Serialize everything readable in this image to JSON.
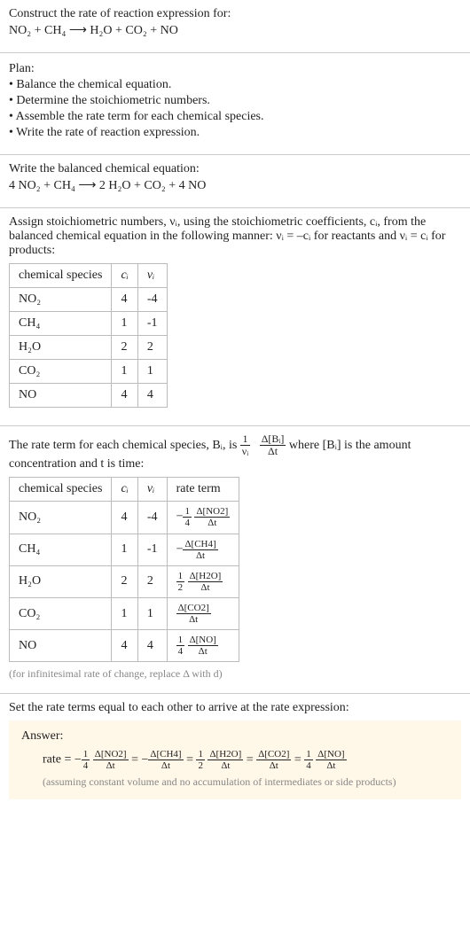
{
  "header": {
    "prompt": "Construct the rate of reaction expression for:",
    "equation": "NO₂ + CH₄ ⟶ H₂O + CO₂ + NO"
  },
  "plan": {
    "title": "Plan:",
    "items": [
      "• Balance the chemical equation.",
      "• Determine the stoichiometric numbers.",
      "• Assemble the rate term for each chemical species.",
      "• Write the rate of reaction expression."
    ]
  },
  "balanced": {
    "intro": "Write the balanced chemical equation:",
    "equation": "4 NO₂ + CH₄ ⟶ 2 H₂O + CO₂ + 4 NO"
  },
  "stoich": {
    "intro": "Assign stoichiometric numbers, νᵢ, using the stoichiometric coefficients, cᵢ, from the balanced chemical equation in the following manner: νᵢ = –cᵢ for reactants and νᵢ = cᵢ for products:",
    "columns": {
      "species": "chemical species",
      "ci": "cᵢ",
      "vi": "νᵢ"
    },
    "rows": [
      {
        "species": "NO₂",
        "ci": "4",
        "vi": "-4"
      },
      {
        "species": "CH₄",
        "ci": "1",
        "vi": "-1"
      },
      {
        "species": "H₂O",
        "ci": "2",
        "vi": "2"
      },
      {
        "species": "CO₂",
        "ci": "1",
        "vi": "1"
      },
      {
        "species": "NO",
        "ci": "4",
        "vi": "4"
      }
    ]
  },
  "rate_term_intro": {
    "before": "The rate term for each chemical species, Bᵢ, is ",
    "frac1_num": "1",
    "frac1_den": "νᵢ",
    "frac2_num": "Δ[Bᵢ]",
    "frac2_den": "Δt",
    "after": " where [Bᵢ] is the amount concentration and t is time:"
  },
  "rate_table": {
    "columns": {
      "species": "chemical species",
      "ci": "cᵢ",
      "vi": "νᵢ",
      "rate": "rate term"
    },
    "rows": [
      {
        "species": "NO₂",
        "ci": "4",
        "vi": "-4",
        "prefix": "−",
        "coef_num": "1",
        "coef_den": "4",
        "d_num": "Δ[NO2]",
        "d_den": "Δt"
      },
      {
        "species": "CH₄",
        "ci": "1",
        "vi": "-1",
        "prefix": "−",
        "coef_num": "",
        "coef_den": "",
        "d_num": "Δ[CH4]",
        "d_den": "Δt"
      },
      {
        "species": "H₂O",
        "ci": "2",
        "vi": "2",
        "prefix": "",
        "coef_num": "1",
        "coef_den": "2",
        "d_num": "Δ[H2O]",
        "d_den": "Δt"
      },
      {
        "species": "CO₂",
        "ci": "1",
        "vi": "1",
        "prefix": "",
        "coef_num": "",
        "coef_den": "",
        "d_num": "Δ[CO2]",
        "d_den": "Δt"
      },
      {
        "species": "NO",
        "ci": "4",
        "vi": "4",
        "prefix": "",
        "coef_num": "1",
        "coef_den": "4",
        "d_num": "Δ[NO]",
        "d_den": "Δt"
      }
    ],
    "caption": "(for infinitesimal rate of change, replace Δ with d)"
  },
  "final": {
    "intro": "Set the rate terms equal to each other to arrive at the rate expression:",
    "answer_label": "Answer:",
    "rate_label": "rate = ",
    "terms": [
      {
        "prefix": "−",
        "coef_num": "1",
        "coef_den": "4",
        "d_num": "Δ[NO2]",
        "d_den": "Δt"
      },
      {
        "prefix": "−",
        "coef_num": "",
        "coef_den": "",
        "d_num": "Δ[CH4]",
        "d_den": "Δt"
      },
      {
        "prefix": "",
        "coef_num": "1",
        "coef_den": "2",
        "d_num": "Δ[H2O]",
        "d_den": "Δt"
      },
      {
        "prefix": "",
        "coef_num": "",
        "coef_den": "",
        "d_num": "Δ[CO2]",
        "d_den": "Δt"
      },
      {
        "prefix": "",
        "coef_num": "1",
        "coef_den": "4",
        "d_num": "Δ[NO]",
        "d_den": "Δt"
      }
    ],
    "sep": " = ",
    "note": "(assuming constant volume and no accumulation of intermediates or side products)"
  }
}
